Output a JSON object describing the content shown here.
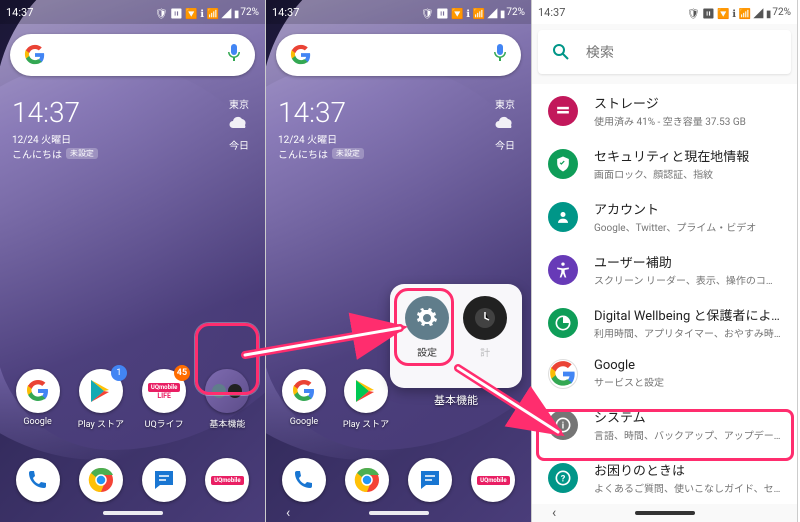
{
  "status": {
    "time": "14:37",
    "battery": "72%"
  },
  "clock": {
    "time": "14:37",
    "date": "12/24 火曜日",
    "greeting": "こんにちは",
    "chip": "未設定"
  },
  "weather": {
    "city": "東京",
    "label": "今日"
  },
  "search": {
    "placeholder": "検索"
  },
  "home_icons": [
    {
      "label": "Google",
      "badge": ""
    },
    {
      "label": "Play ストア",
      "badge": "1"
    },
    {
      "label": "UQライフ",
      "badge": "45"
    },
    {
      "label": "基本機能",
      "badge": ""
    }
  ],
  "folder": {
    "name": "基本機能",
    "items": [
      {
        "label": "設定"
      },
      {
        "label": "時計"
      }
    ]
  },
  "settings": [
    {
      "title": "ストレージ",
      "sub": "使用済み 41% - 空き容量 37.53 GB",
      "color": "#c2185b",
      "icon": "storage"
    },
    {
      "title": "セキュリティと現在地情報",
      "sub": "画面ロック、顔認証、指紋",
      "color": "#0f9d58",
      "icon": "security"
    },
    {
      "title": "アカウント",
      "sub": "Google、Twitter、プライム・ビデオ",
      "color": "#009688",
      "icon": "account"
    },
    {
      "title": "ユーザー補助",
      "sub": "スクリーン リーダー、表示、操作のコン…",
      "color": "#673ab7",
      "icon": "accessibility"
    },
    {
      "title": "Digital Wellbeing と保護者による使用…",
      "sub": "利用時間、アプリタイマー、おやすみ時…",
      "color": "#0f9d58",
      "icon": "wellbeing"
    },
    {
      "title": "Google",
      "sub": "サービスと設定",
      "color": "#fff",
      "icon": "google"
    },
    {
      "title": "システム",
      "sub": "言語、時間、バックアップ、アップデート",
      "color": "#757575",
      "icon": "system"
    },
    {
      "title": "お困りのときは",
      "sub": "よくあるご質問、使いこなしガイド、セ…",
      "color": "#009688",
      "icon": "help"
    }
  ]
}
